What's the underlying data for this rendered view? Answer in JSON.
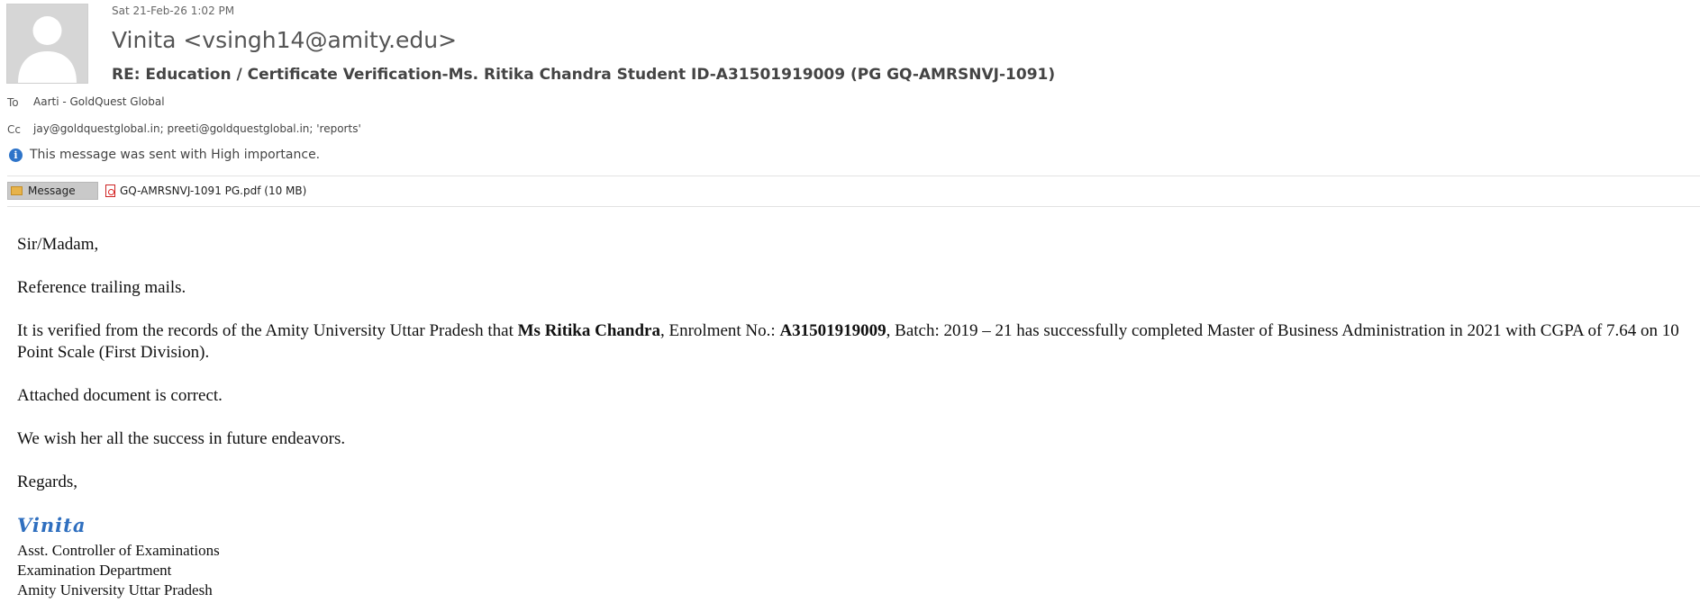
{
  "header": {
    "sent_date": "Sat 21-Feb-26 1:02 PM",
    "sender": "Vinita <vsingh14@amity.edu>",
    "subject": "RE: Education / Certificate Verification-Ms. Ritika Chandra Student ID-A31501919009 (PG GQ-AMRSNVJ-1091)",
    "avatar_icon": "person-placeholder-icon"
  },
  "recipients": {
    "to_label": "To",
    "to_value": "Aarti - GoldQuest Global",
    "cc_label": "Cc",
    "cc_value": "jay@goldquestglobal.in; preeti@goldquestglobal.in; 'reports'"
  },
  "importance_notice": "This message was sent with High importance.",
  "tabs": {
    "message_label": "Message",
    "attachment_label": "GQ-AMRSNVJ-1091 PG.pdf (10 MB)"
  },
  "body": {
    "greeting": "Sir/Madam,",
    "reference": "Reference trailing mails.",
    "verified": {
      "part1": "It is verified from the records of the Amity University Uttar Pradesh that ",
      "student_name": "Ms Ritika Chandra",
      "part2": ", Enrolment No.: ",
      "enrolment_no": "A31501919009",
      "part3": ", Batch: 2019 – 21 has successfully completed Master of Business Administration in 2021 with CGPA of 7.64 on 10 Point Scale (First Division)."
    },
    "attached": "Attached document is correct.",
    "wish": "We wish her all the success in future endeavors.",
    "regards": "Regards,",
    "signature_name": "Vinita",
    "signature_lines": [
      "Asst. Controller of Examinations",
      "Examination Department",
      "Amity University Uttar Pradesh"
    ]
  },
  "colors": {
    "signature": "#2f6fbf",
    "info_icon": "#2e74c9",
    "message_tab_bg": "#c9c9c9"
  }
}
